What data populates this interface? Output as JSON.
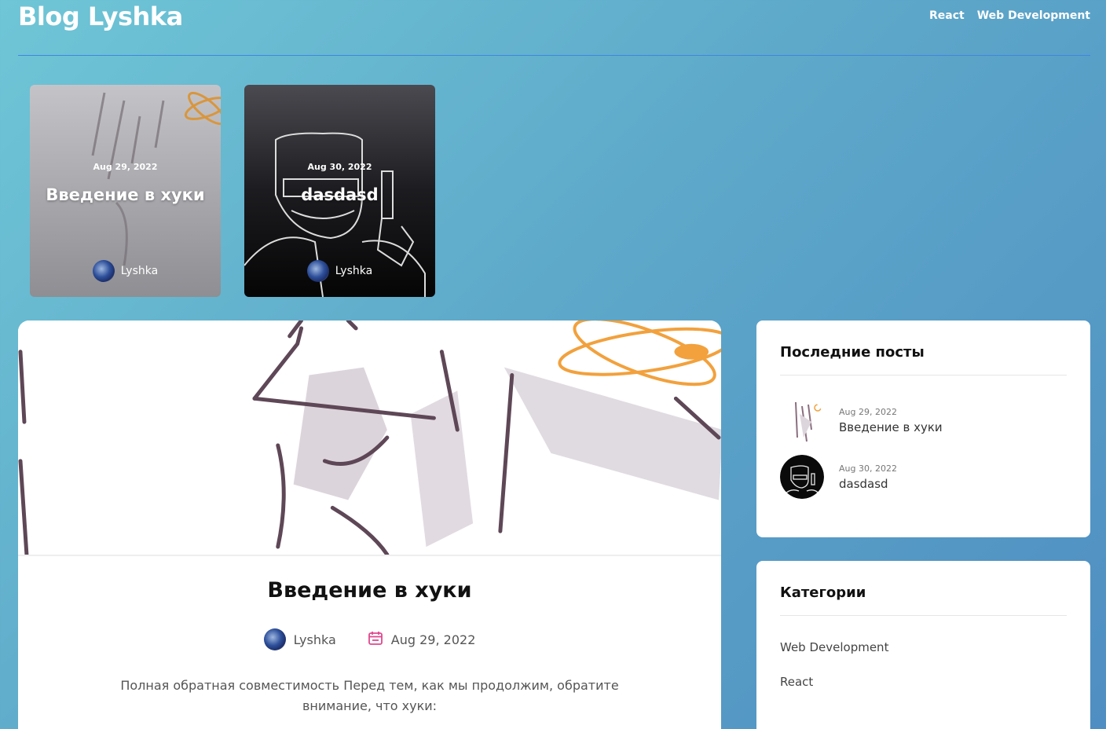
{
  "header": {
    "brand": "Blog Lyshka",
    "nav": [
      "React",
      "Web Development"
    ]
  },
  "featured": [
    {
      "date": "Aug 29, 2022",
      "title": "Введение в хуки",
      "author": "Lyshka"
    },
    {
      "date": "Aug 30, 2022",
      "title": "dasdasd",
      "author": "Lyshka"
    }
  ],
  "post": {
    "title": "Введение в хуки",
    "author": "Lyshka",
    "date": "Aug 29, 2022",
    "excerpt": "Полная обратная совместимость Перед тем, как мы продолжим, обратите внимание, что хуки:"
  },
  "sidebar": {
    "recent_title": "Последние посты",
    "recent": [
      {
        "date": "Aug 29, 2022",
        "title": "Введение в хуки"
      },
      {
        "date": "Aug 30, 2022",
        "title": "dasdasd"
      }
    ],
    "categories_title": "Категории",
    "categories": [
      "Web Development",
      "React"
    ]
  },
  "colors": {
    "accent_pink": "#e0488f",
    "header_line": "#3f86e0"
  },
  "icons": {
    "date": "calendar-icon"
  }
}
